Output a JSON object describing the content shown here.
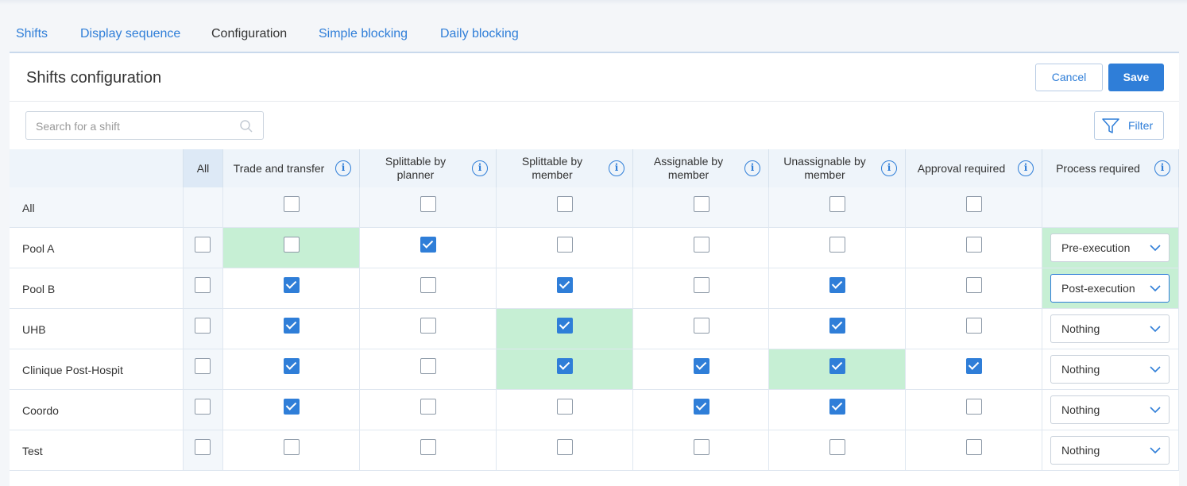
{
  "tabs": [
    {
      "label": "Shifts",
      "active": false
    },
    {
      "label": "Display sequence",
      "active": false
    },
    {
      "label": "Configuration",
      "active": true
    },
    {
      "label": "Simple blocking",
      "active": false
    },
    {
      "label": "Daily blocking",
      "active": false
    }
  ],
  "page": {
    "title": "Shifts configuration",
    "cancel_label": "Cancel",
    "save_label": "Save",
    "search_placeholder": "Search for a shift",
    "search_value": "",
    "filter_label": "Filter"
  },
  "table": {
    "all_column_label": "All",
    "columns": [
      {
        "label": "Trade and transfer"
      },
      {
        "label": "Splittable by planner"
      },
      {
        "label": "Splittable by member"
      },
      {
        "label": "Assignable by member"
      },
      {
        "label": "Unassignable by member"
      },
      {
        "label": "Approval required"
      },
      {
        "label": "Process required"
      }
    ],
    "all_row": {
      "label": "All",
      "checks": [
        false,
        false,
        false,
        false,
        false,
        false
      ]
    },
    "rows": [
      {
        "label": "Pool A",
        "all": false,
        "checks": [
          false,
          true,
          false,
          false,
          false,
          false
        ],
        "process": "Pre-execution",
        "changed": [
          true,
          false,
          false,
          false,
          false,
          false,
          true
        ]
      },
      {
        "label": "Pool B",
        "all": false,
        "checks": [
          true,
          false,
          true,
          false,
          true,
          false
        ],
        "process": "Post-execution",
        "changed": [
          false,
          false,
          false,
          false,
          false,
          false,
          true
        ]
      },
      {
        "label": "UHB",
        "all": false,
        "checks": [
          true,
          false,
          true,
          false,
          true,
          false
        ],
        "process": "Nothing",
        "changed": [
          false,
          false,
          true,
          false,
          false,
          false,
          false
        ]
      },
      {
        "label": "Clinique Post-Hospit",
        "all": false,
        "checks": [
          true,
          false,
          true,
          true,
          true,
          true
        ],
        "process": "Nothing",
        "changed": [
          false,
          false,
          true,
          false,
          true,
          false,
          false
        ]
      },
      {
        "label": "Coordo",
        "all": false,
        "checks": [
          true,
          false,
          false,
          true,
          true,
          false
        ],
        "process": "Nothing",
        "changed": [
          false,
          false,
          false,
          false,
          false,
          false,
          false
        ]
      },
      {
        "label": "Test",
        "all": false,
        "checks": [
          false,
          false,
          false,
          false,
          false,
          false
        ],
        "process": "Nothing",
        "changed": [
          false,
          false,
          false,
          false,
          false,
          false,
          false
        ]
      }
    ]
  },
  "colors": {
    "accent": "#2f7ed8",
    "changed_cell": "#c6efd4",
    "header_bg": "#eef4fa"
  }
}
